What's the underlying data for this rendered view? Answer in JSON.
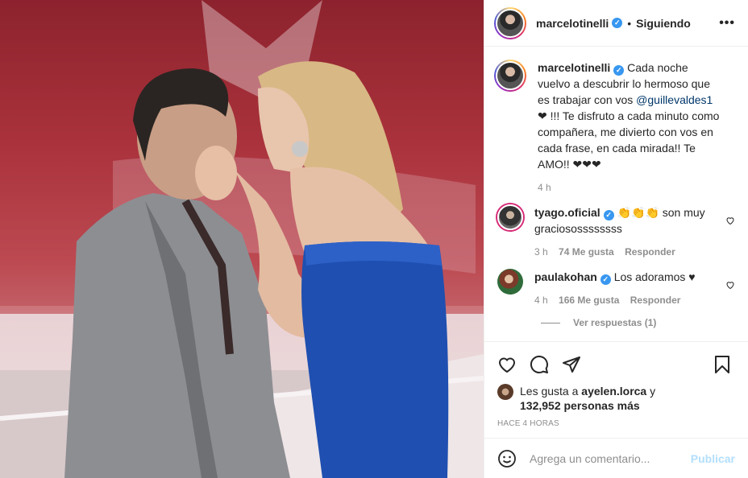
{
  "header": {
    "username": "marcelotinelli",
    "dot": "•",
    "follow_status": "Siguiendo",
    "more_label": "•••"
  },
  "caption": {
    "username": "marcelotinelli",
    "text_before": "Cada noche vuelvo a descubrir lo hermoso que es trabajar con vos ",
    "mention": "@guillevaldes1",
    "text_after": " ❤ !!! Te disfruto a cada minuto como compañera, me divierto con vos en cada frase, en cada mirada!! Te AMO!! ❤❤❤",
    "time": "4 h"
  },
  "comments": [
    {
      "username": "tyago.oficial",
      "text": "👏👏👏 son muy graciosossssssss",
      "time": "3 h",
      "likes": "74 Me gusta",
      "reply": "Responder"
    },
    {
      "username": "paulakohan",
      "text": "Los adoramos ♥",
      "time": "4 h",
      "likes": "166 Me gusta",
      "reply": "Responder"
    }
  ],
  "view_replies": "Ver respuestas (1)",
  "likes_line": {
    "prefix": "Les gusta a ",
    "user": "ayelen.lorca",
    "middle": " y",
    "count": "132,952 personas más"
  },
  "posted_ago": "HACE 4 HORAS",
  "add_comment": {
    "placeholder": "Agrega un comentario...",
    "publish": "Publicar"
  },
  "colors": {
    "verified": "#3897f0",
    "mention": "#00376b",
    "publish_disabled": "#b2dffc",
    "secondary_text": "#8e8e8e"
  },
  "icons": [
    "heart-icon",
    "comment-icon",
    "share-icon",
    "bookmark-icon",
    "emoji-icon",
    "small-heart-icon",
    "verified-icon"
  ]
}
